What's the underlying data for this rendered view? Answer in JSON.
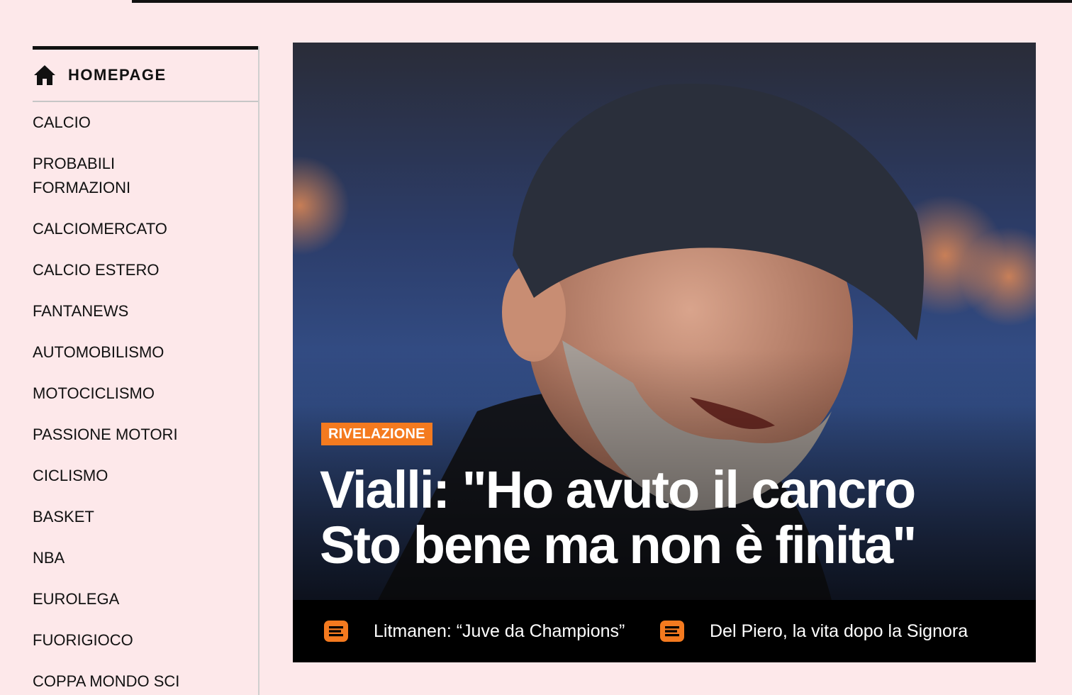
{
  "sidebar": {
    "home_label": "HOMEPAGE",
    "items": [
      {
        "label": "CALCIO"
      },
      {
        "label": "PROBABILI\nFORMAZIONI"
      },
      {
        "label": "CALCIOMERCATO"
      },
      {
        "label": "CALCIO ESTERO"
      },
      {
        "label": "FANTANEWS"
      },
      {
        "label": "AUTOMOBILISMO"
      },
      {
        "label": "MOTOCICLISMO"
      },
      {
        "label": "PASSIONE MOTORI"
      },
      {
        "label": "CICLISMO"
      },
      {
        "label": "BASKET"
      },
      {
        "label": "NBA"
      },
      {
        "label": "EUROLEGA"
      },
      {
        "label": "FUORIGIOCO"
      },
      {
        "label": "COPPA MONDO SCI"
      }
    ]
  },
  "hero": {
    "badge": "RIVELAZIONE",
    "headline": "Vialli: \"Ho avuto il cancro Sto bene ma non è finita\"",
    "related": [
      {
        "icon": "article-icon",
        "text": "Litmanen: “Juve da Champions”"
      },
      {
        "icon": "article-icon",
        "text": "Del Piero, la vita dopo la Signora"
      }
    ]
  },
  "colors": {
    "page_background": "#fde8ea",
    "accent_orange": "#f47a1f",
    "text_dark": "#111111"
  }
}
